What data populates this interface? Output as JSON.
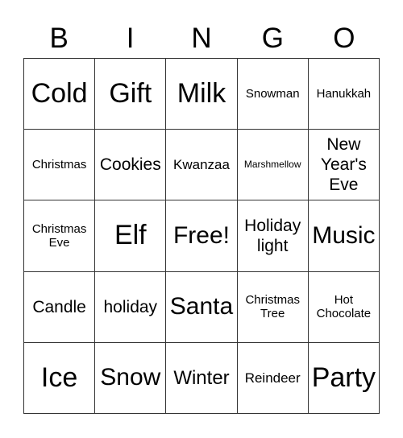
{
  "header": [
    "B",
    "I",
    "N",
    "G",
    "O"
  ],
  "cells": [
    "Cold",
    "Gift",
    "Milk",
    "Snowman",
    "Hanukkah",
    "Christmas",
    "Cookies",
    "Kwanzaa",
    "Marshmellow",
    "New Year's Eve",
    "Christmas Eve",
    "Elf",
    "Free!",
    "Holiday light",
    "Music",
    "Candle",
    "holiday",
    "Santa",
    "Christmas Tree",
    "Hot Chocolate",
    "Ice",
    "Snow",
    "Winter",
    "Reindeer",
    "Party"
  ]
}
